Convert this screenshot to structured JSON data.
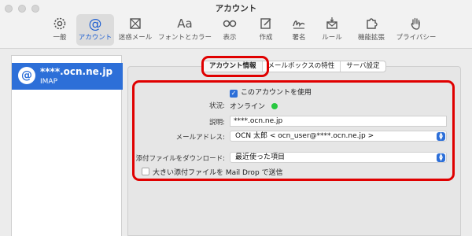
{
  "window": {
    "title": "アカウント"
  },
  "toolbar": {
    "items": [
      {
        "label": "一般",
        "icon": "gear-icon"
      },
      {
        "label": "アカウント",
        "icon": "at-icon",
        "active": true
      },
      {
        "label": "迷惑メール",
        "icon": "junk-mail-icon"
      },
      {
        "label": "フォントとカラー",
        "icon": "fonts-icon",
        "glyph": "Aa"
      },
      {
        "label": "表示",
        "icon": "glasses-icon"
      },
      {
        "label": "作成",
        "icon": "compose-icon"
      },
      {
        "label": "署名",
        "icon": "signature-icon"
      },
      {
        "label": "ルール",
        "icon": "rules-icon"
      },
      {
        "label": "機能拡張",
        "icon": "puzzle-icon"
      },
      {
        "label": "プライバシー",
        "icon": "hand-icon"
      }
    ]
  },
  "sidebar": {
    "accounts": [
      {
        "badge": "@",
        "name": "****.ocn.ne.jp",
        "type": "IMAP"
      }
    ]
  },
  "tabs": [
    {
      "label": "アカウント情報",
      "selected": true
    },
    {
      "label": "メールボックスの特性"
    },
    {
      "label": "サーバ設定"
    }
  ],
  "form": {
    "enable_label": "このアカウントを使用",
    "enable_checked": true,
    "status_label": "状況:",
    "status_value": "オンライン",
    "status_color": "#28c840",
    "description_label": "説明:",
    "description_value": "****.ocn.ne.jp",
    "email_label": "メールアドレス:",
    "email_value": "OCN 太郎 < ocn_user@****.ocn.ne.jp >",
    "download_label": "添付ファイルをダウンロード:",
    "download_value": "最近使った項目",
    "maildrop_label": "大きい添付ファイルを Mail Drop で送信",
    "maildrop_checked": false
  },
  "colors": {
    "accent": "#2d6fd8",
    "highlight": "#e00000"
  }
}
